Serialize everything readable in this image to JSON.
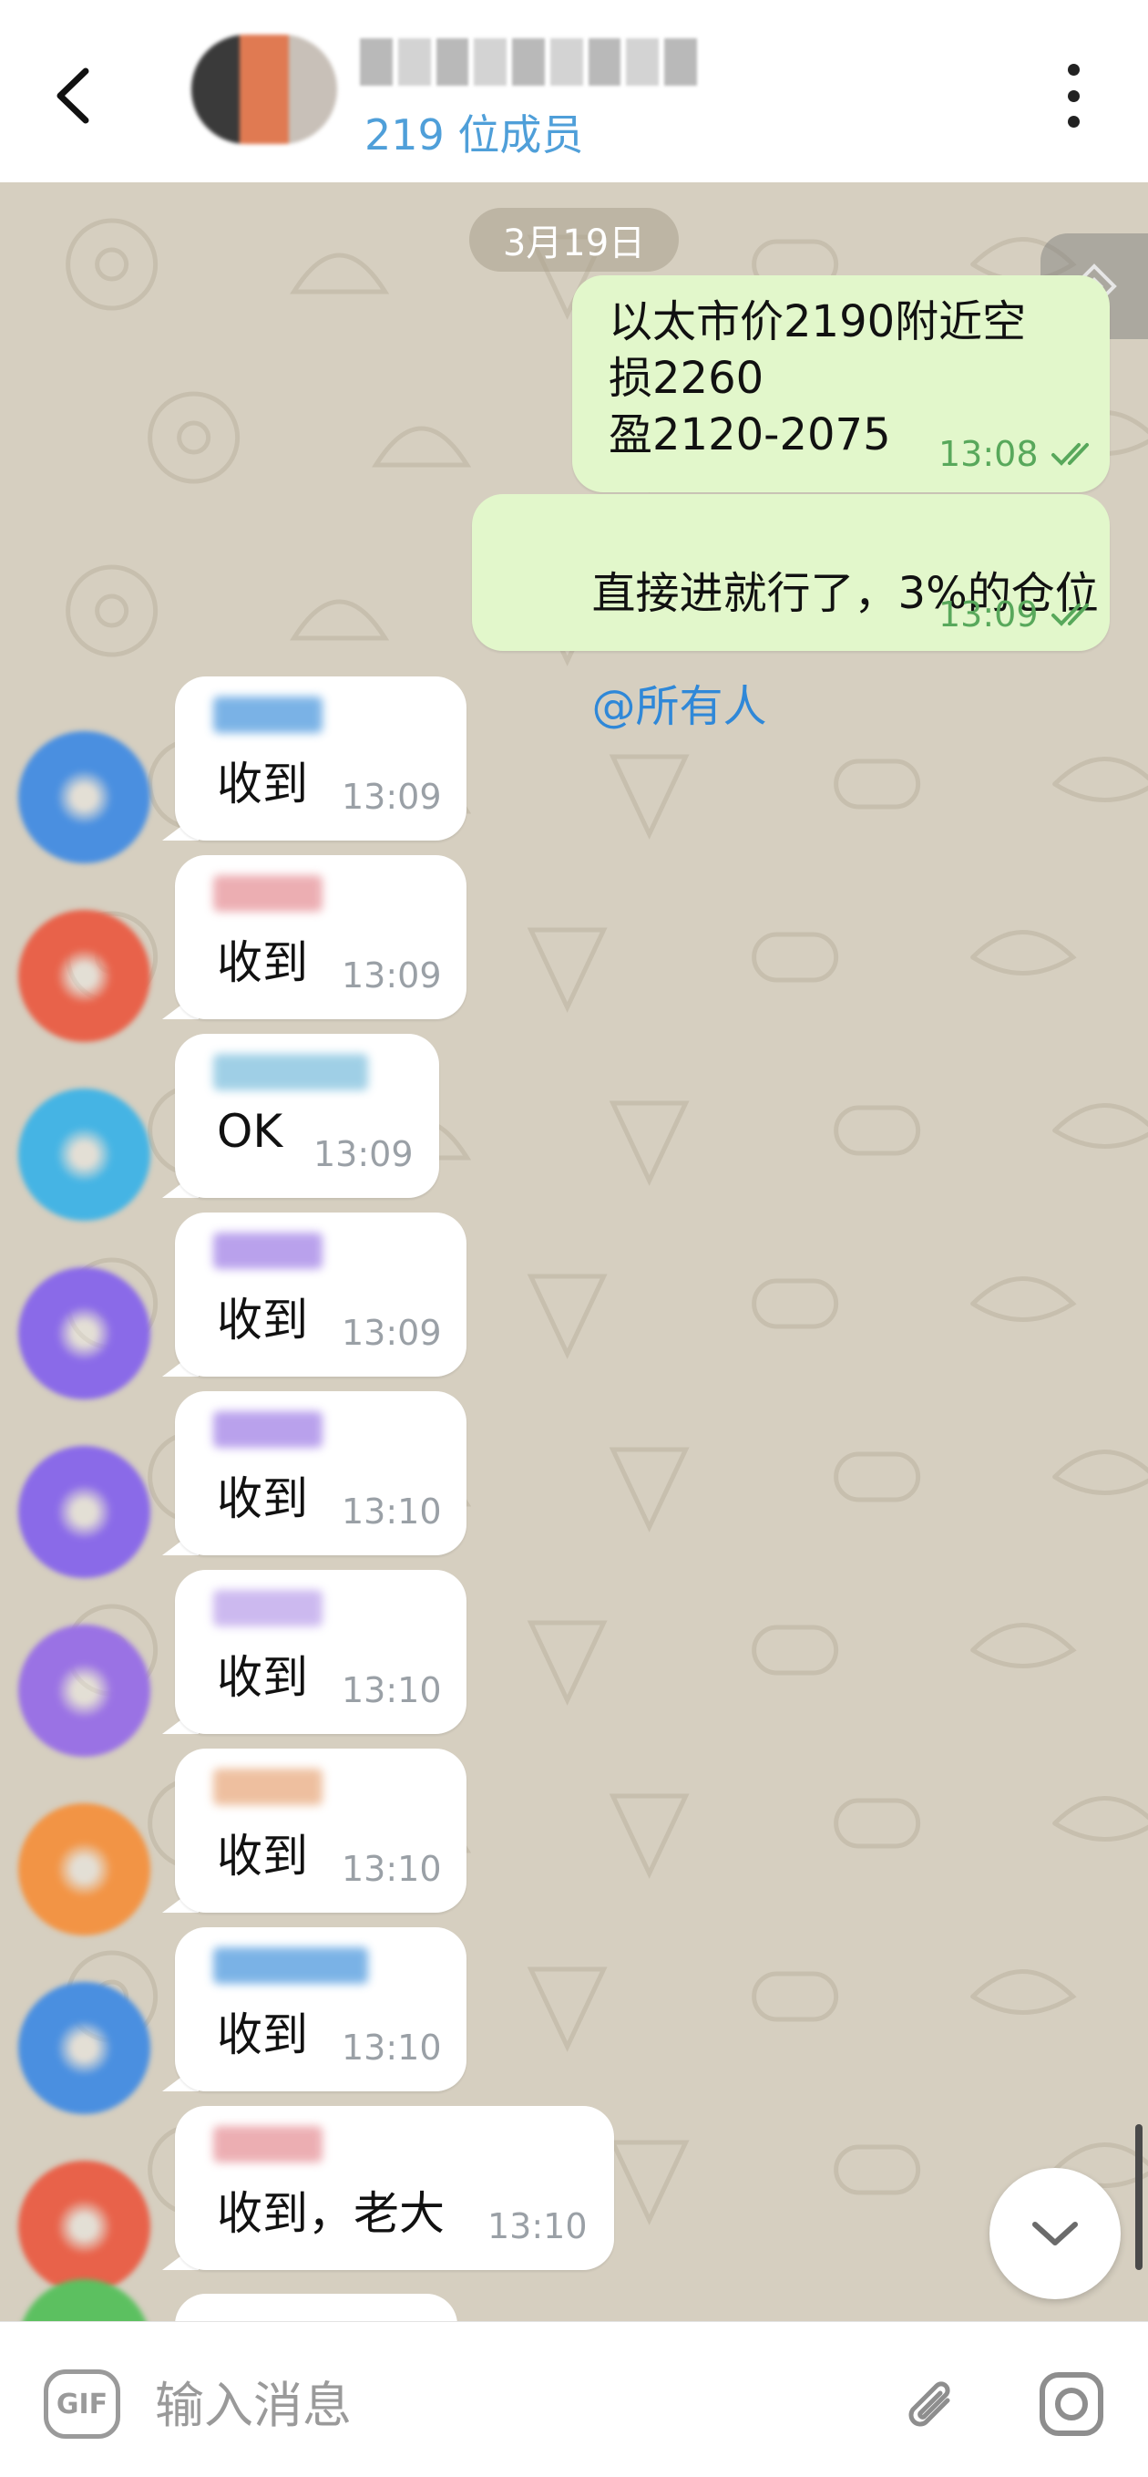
{
  "header": {
    "member_count": "219 位成员",
    "group_avatar_colors": [
      "#3a3a3a",
      "#e07a52",
      "#c8c0b8"
    ],
    "name_text_color": "#bdbdbd"
  },
  "chat": {
    "date_label": "3月19日",
    "wallpaper_color": "#d6cfc0",
    "outgoing": [
      {
        "lines": "以太市价2190附近空\n损2260\n盈2120-2075",
        "time": "13:08",
        "status": "read"
      },
      {
        "line1": "直接进就行了，3%的仓位",
        "mention": "@所有人",
        "time": "13:09",
        "status": "read"
      }
    ],
    "incoming": [
      {
        "text": "收到",
        "time": "13:09",
        "avatar_color": "#4a8fe0",
        "name_color": "#5aa0e0"
      },
      {
        "text": "收到",
        "time": "13:09",
        "avatar_color": "#e8624a",
        "name_color": "#e89aa0"
      },
      {
        "text": "OK",
        "time": "13:09",
        "avatar_color": "#45b4e4",
        "name_color": "#88c4e0"
      },
      {
        "text": "收到",
        "time": "13:09",
        "avatar_color": "#8a6ae8",
        "name_color": "#a88ae8"
      },
      {
        "text": "收到",
        "time": "13:10",
        "avatar_color": "#8a6ae8",
        "name_color": "#a88ae8"
      },
      {
        "text": "收到",
        "time": "13:10",
        "avatar_color": "#9a72e4",
        "name_color": "#c0a8ec"
      },
      {
        "text": "收到",
        "time": "13:10",
        "avatar_color": "#f29445",
        "name_color": "#eab088"
      },
      {
        "text": "收到",
        "time": "13:10",
        "avatar_color": "#4a8fe0",
        "name_color": "#5aa0e0"
      },
      {
        "text": "收到，老大",
        "time": "13:10",
        "avatar_color": "#e8624a",
        "name_color": "#e89aa0"
      }
    ],
    "partial_avatar_color": "#5cc060"
  },
  "input_bar": {
    "gif_label": "GIF",
    "placeholder": "输入消息"
  },
  "icons": [
    "back-arrow-icon",
    "more-vertical-icon",
    "sticker-icon",
    "read-ticks-icon",
    "chevron-down-icon",
    "gif-icon",
    "paperclip-icon",
    "camera-icon"
  ]
}
